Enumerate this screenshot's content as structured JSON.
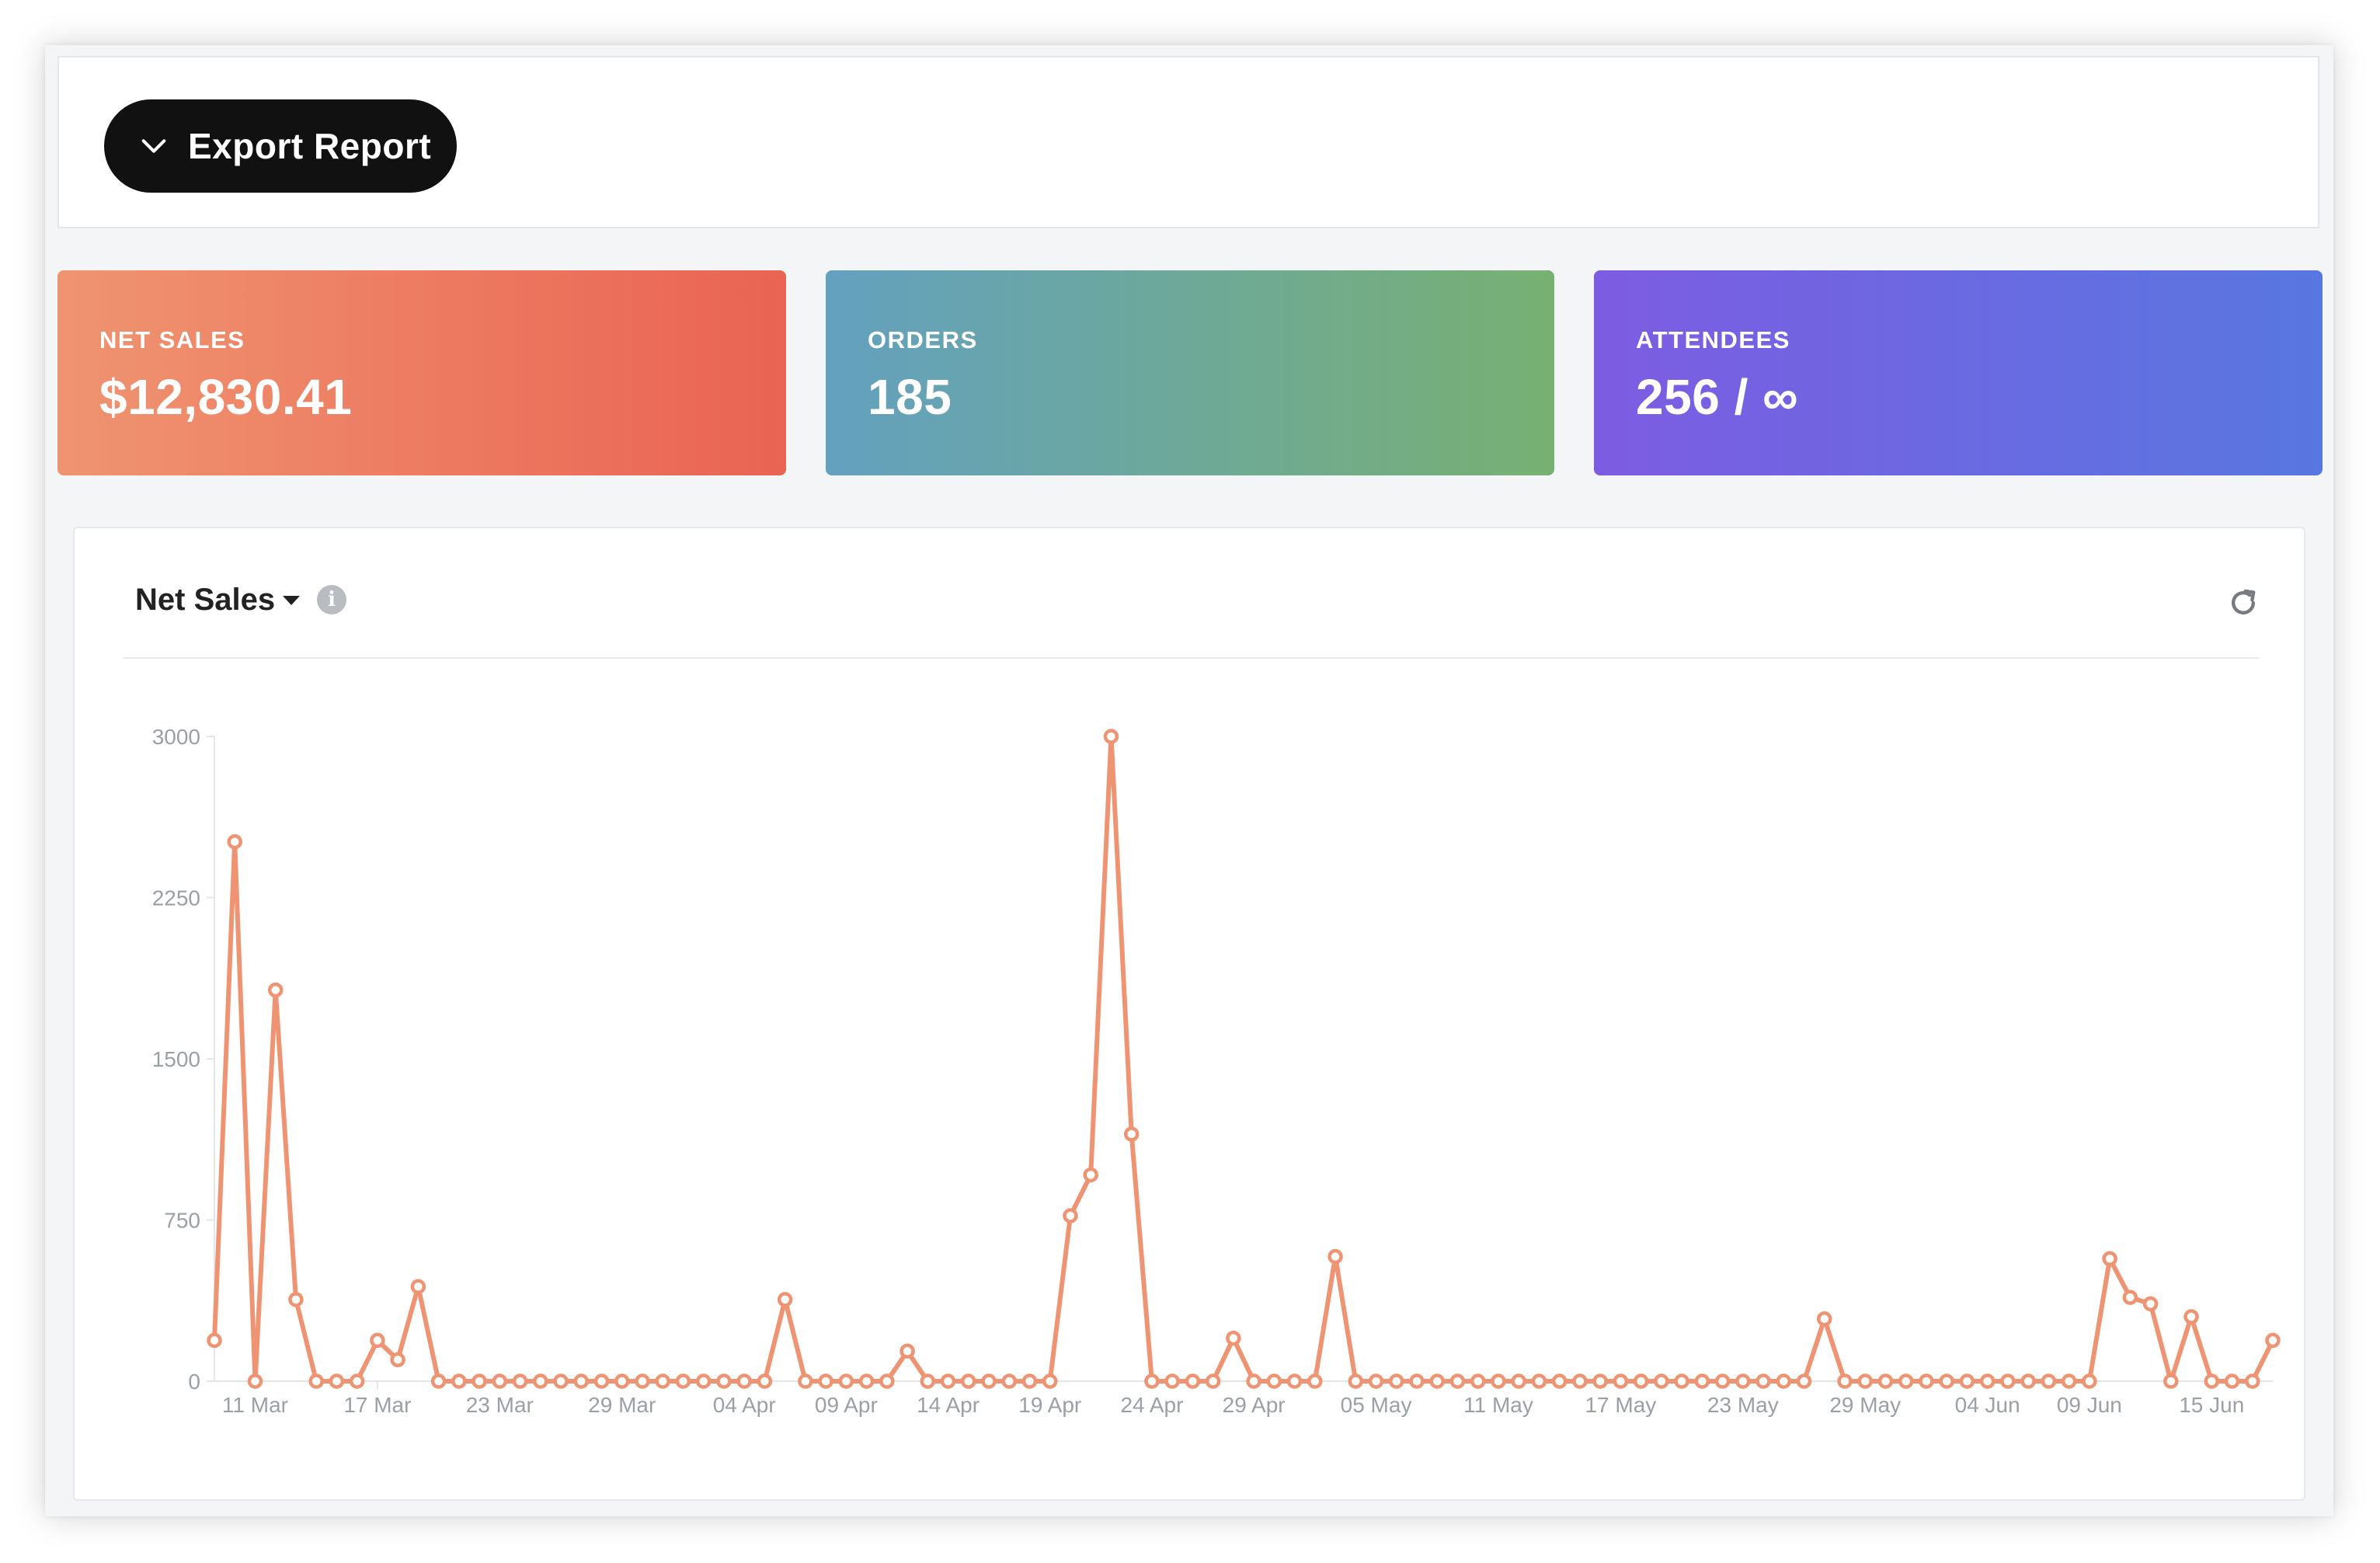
{
  "toolbar": {
    "export_label": "Export Report"
  },
  "stats": {
    "net_sales": {
      "label": "NET SALES",
      "value": "$12,830.41"
    },
    "orders": {
      "label": "ORDERS",
      "value": "185"
    },
    "attendees": {
      "label": "ATTENDEES",
      "value": "256 / ∞"
    }
  },
  "chart_header": {
    "title": "Net Sales",
    "info_icon": "info-icon",
    "refresh_icon": "refresh-icon"
  },
  "colors": {
    "line": "#ef9472",
    "sales_card": "#ea6353",
    "orders_card": "#6fa99a",
    "attendees_card": "#6b69e1"
  },
  "chart_data": {
    "type": "line",
    "x": [
      "09 Mar",
      "10 Mar",
      "11 Mar",
      "12 Mar",
      "13 Mar",
      "14 Mar",
      "15 Mar",
      "16 Mar",
      "17 Mar",
      "18 Mar",
      "19 Mar",
      "20 Mar",
      "21 Mar",
      "22 Mar",
      "23 Mar",
      "24 Mar",
      "25 Mar",
      "26 Mar",
      "27 Mar",
      "28 Mar",
      "29 Mar",
      "30 Mar",
      "31 Mar",
      "01 Apr",
      "02 Apr",
      "03 Apr",
      "04 Apr",
      "05 Apr",
      "06 Apr",
      "07 Apr",
      "08 Apr",
      "09 Apr",
      "10 Apr",
      "11 Apr",
      "12 Apr",
      "13 Apr",
      "14 Apr",
      "15 Apr",
      "16 Apr",
      "17 Apr",
      "18 Apr",
      "19 Apr",
      "20 Apr",
      "21 Apr",
      "22 Apr",
      "23 Apr",
      "24 Apr",
      "25 Apr",
      "26 Apr",
      "27 Apr",
      "28 Apr",
      "29 Apr",
      "30 Apr",
      "01 May",
      "02 May",
      "03 May",
      "04 May",
      "05 May",
      "06 May",
      "07 May",
      "08 May",
      "09 May",
      "10 May",
      "11 May",
      "12 May",
      "13 May",
      "14 May",
      "15 May",
      "16 May",
      "17 May",
      "18 May",
      "19 May",
      "20 May",
      "21 May",
      "22 May",
      "23 May",
      "24 May",
      "25 May",
      "26 May",
      "27 May",
      "28 May",
      "29 May",
      "30 May",
      "31 May",
      "01 Jun",
      "02 Jun",
      "03 Jun",
      "04 Jun",
      "05 Jun",
      "06 Jun",
      "07 Jun",
      "08 Jun",
      "09 Jun",
      "10 Jun",
      "11 Jun",
      "12 Jun",
      "13 Jun",
      "14 Jun",
      "15 Jun",
      "16 Jun"
    ],
    "values": [
      190,
      2510,
      0,
      1820,
      380,
      0,
      0,
      0,
      190,
      100,
      440,
      0,
      0,
      0,
      0,
      0,
      0,
      0,
      0,
      0,
      0,
      0,
      0,
      0,
      0,
      0,
      0,
      0,
      380,
      0,
      0,
      0,
      0,
      0,
      140,
      0,
      0,
      0,
      0,
      0,
      0,
      0,
      770,
      960,
      3000,
      1150,
      0,
      0,
      0,
      0,
      200,
      0,
      0,
      0,
      0,
      580,
      0,
      0,
      0,
      0,
      0,
      0,
      0,
      0,
      0,
      0,
      0,
      0,
      0,
      0,
      0,
      0,
      0,
      0,
      0,
      0,
      0,
      0,
      0,
      290,
      0,
      0,
      0,
      0,
      0,
      0,
      0,
      0,
      0,
      0,
      0,
      0,
      0,
      570,
      390,
      360,
      0,
      300,
      0,
      0,
      0,
      190
    ],
    "x_tick_labels": [
      "11 Mar",
      "17 Mar",
      "23 Mar",
      "29 Mar",
      "04 Apr",
      "09 Apr",
      "14 Apr",
      "19 Apr",
      "24 Apr",
      "29 Apr",
      "05 May",
      "11 May",
      "17 May",
      "23 May",
      "29 May",
      "04 Jun",
      "09 Jun",
      "15 Jun"
    ],
    "y_ticks": [
      0,
      750,
      1500,
      2250,
      3000
    ],
    "ylim": [
      0,
      3000
    ],
    "title": "",
    "xlabel": "",
    "ylabel": "",
    "grid": false,
    "legend": "none"
  }
}
